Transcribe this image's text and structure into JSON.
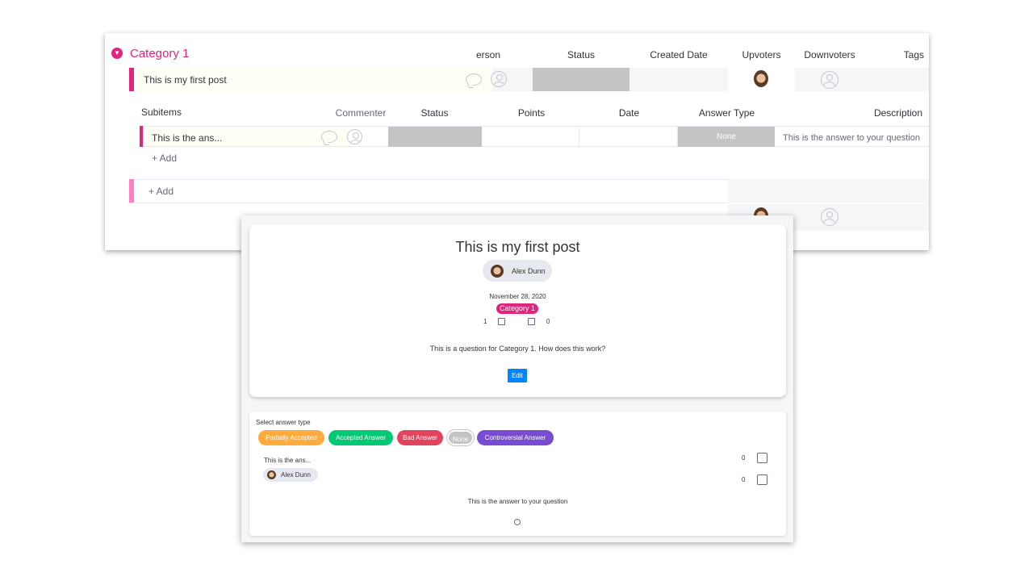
{
  "board": {
    "group": {
      "title": "Category 1",
      "color": "#e2247f",
      "columns": [
        "erson",
        "Status",
        "Created Date",
        "Upvoters",
        "Downvoters",
        "Tags"
      ]
    },
    "item": {
      "title": "This is my first post"
    },
    "subitems": {
      "label": "Subitems",
      "columns": [
        "Commenter",
        "Status",
        "Points",
        "Date",
        "Answer Type",
        "Description"
      ],
      "row": {
        "title": "This is the ans...",
        "answer_type": "None",
        "description": "This is the answer to your question"
      },
      "add_label": "+ Add"
    },
    "add_item_label": "+ Add"
  },
  "post": {
    "title": "This is my first post",
    "author": "Alex Dunn",
    "date": "November 28, 2020",
    "category": "Category 1",
    "upvotes": "1",
    "downvotes": "0",
    "question": "This is a question for Category 1. How does this work?",
    "edit_label": "Edit"
  },
  "answer_panel": {
    "select_label": "Select answer type",
    "types": [
      {
        "label": "Partially Accepted",
        "color": "#fdab3d"
      },
      {
        "label": "Accepted Answer",
        "color": "#00c875"
      },
      {
        "label": "Bad Answer",
        "color": "#e2445c"
      },
      {
        "label": "None",
        "color": "#c4c4c4"
      },
      {
        "label": "Controversial Answer",
        "color": "#784bd1"
      }
    ],
    "answer": {
      "title": "This is the ans...",
      "author": "Alex Dunn",
      "upvotes": "0",
      "downvotes": "0",
      "text": "This is the answer to your question"
    }
  }
}
